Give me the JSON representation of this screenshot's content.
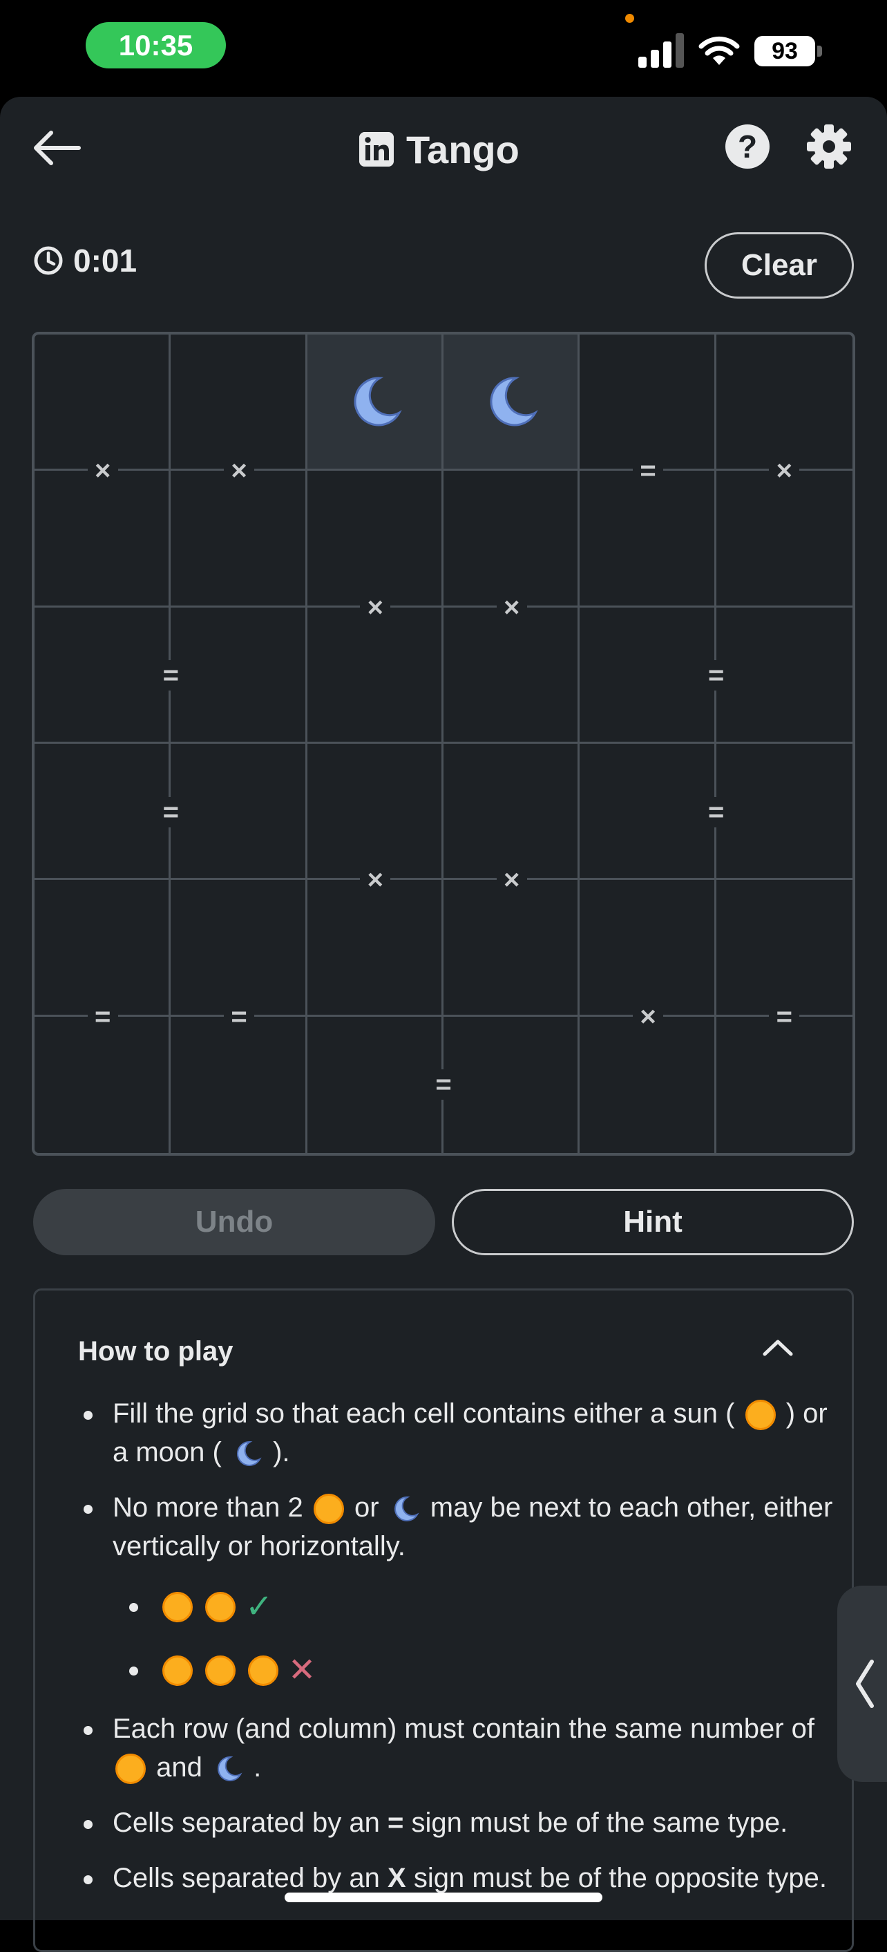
{
  "status_bar": {
    "time": "10:35",
    "battery": "93"
  },
  "header": {
    "title": "Tango",
    "help_label": "?"
  },
  "timer": "0:01",
  "clear_label": "Clear",
  "grid": {
    "rows": 6,
    "cols": 6,
    "cells": [
      [
        "",
        "",
        "moon",
        "moon",
        "",
        ""
      ],
      [
        "",
        "",
        "",
        "",
        "",
        ""
      ],
      [
        "",
        "",
        "",
        "",
        "",
        ""
      ],
      [
        "",
        "",
        "",
        "",
        "",
        ""
      ],
      [
        "",
        "",
        "",
        "",
        "",
        ""
      ],
      [
        "",
        "",
        "",
        "",
        "",
        ""
      ]
    ],
    "locked": [
      [
        0,
        2
      ],
      [
        0,
        3
      ]
    ],
    "constraints": [
      {
        "between": [
          [
            0,
            0
          ],
          [
            1,
            0
          ]
        ],
        "sign": "×"
      },
      {
        "between": [
          [
            0,
            1
          ],
          [
            1,
            1
          ]
        ],
        "sign": "×"
      },
      {
        "between": [
          [
            0,
            4
          ],
          [
            1,
            4
          ]
        ],
        "sign": "="
      },
      {
        "between": [
          [
            0,
            5
          ],
          [
            1,
            5
          ]
        ],
        "sign": "×"
      },
      {
        "between": [
          [
            1,
            2
          ],
          [
            2,
            2
          ]
        ],
        "sign": "×"
      },
      {
        "between": [
          [
            1,
            3
          ],
          [
            2,
            3
          ]
        ],
        "sign": "×"
      },
      {
        "between": [
          [
            2,
            0
          ],
          [
            2,
            1
          ]
        ],
        "sign": "="
      },
      {
        "between": [
          [
            2,
            4
          ],
          [
            2,
            5
          ]
        ],
        "sign": "="
      },
      {
        "between": [
          [
            3,
            0
          ],
          [
            3,
            1
          ]
        ],
        "sign": "="
      },
      {
        "between": [
          [
            3,
            4
          ],
          [
            3,
            5
          ]
        ],
        "sign": "="
      },
      {
        "between": [
          [
            3,
            2
          ],
          [
            4,
            2
          ]
        ],
        "sign": "×"
      },
      {
        "between": [
          [
            3,
            3
          ],
          [
            4,
            3
          ]
        ],
        "sign": "×"
      },
      {
        "between": [
          [
            4,
            0
          ],
          [
            5,
            0
          ]
        ],
        "sign": "="
      },
      {
        "between": [
          [
            4,
            1
          ],
          [
            5,
            1
          ]
        ],
        "sign": "="
      },
      {
        "between": [
          [
            4,
            4
          ],
          [
            5,
            4
          ]
        ],
        "sign": "×"
      },
      {
        "between": [
          [
            4,
            5
          ],
          [
            5,
            5
          ]
        ],
        "sign": "="
      },
      {
        "between": [
          [
            5,
            2
          ],
          [
            5,
            3
          ]
        ],
        "sign": "="
      }
    ]
  },
  "buttons": {
    "undo": "Undo",
    "hint": "Hint"
  },
  "how_to_play": {
    "title": "How to play",
    "rule1": {
      "a": "Fill the grid so that each cell contains either a sun (",
      "b": ") or a moon (",
      "c": ")."
    },
    "rule2": {
      "a": "No more than 2",
      "b": "or",
      "c": "may be next to each other, either vertically or horizontally."
    },
    "rule3": {
      "a": "Each row (and column) must contain the same number of",
      "b": "and",
      "c": "."
    },
    "rule4": {
      "a": "Cells separated by an",
      "sign": "=",
      "b": "sign must be of the same type."
    },
    "rule5": {
      "a": "Cells separated by an",
      "sign": "X",
      "b": "sign must be of the opposite type."
    },
    "check_glyph": "✓",
    "cross_glyph": "✕"
  }
}
